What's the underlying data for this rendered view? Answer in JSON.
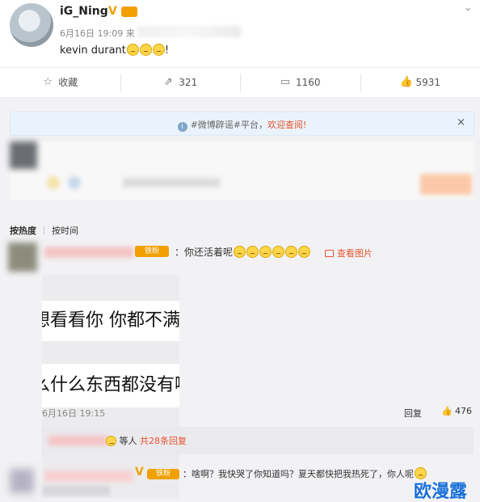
{
  "post": {
    "username": "iG_Ning",
    "time": "6月16日 19:09 来",
    "text": "kevin durant",
    "text_suffix": "!",
    "verified_icon": "verified-v-icon"
  },
  "actions": [
    {
      "icon": "star-icon",
      "label": "收藏"
    },
    {
      "icon": "share-icon",
      "label": "321"
    },
    {
      "icon": "comment-icon",
      "label": "1160"
    },
    {
      "icon": "thumbs-up-icon",
      "label": "5931"
    }
  ],
  "notice": {
    "text": "#微博辟谣#平台，",
    "highlight": "欢迎查阅!",
    "close": "×"
  },
  "sort": {
    "hot": "按热度",
    "time": "按时间"
  },
  "comment1": {
    "fan_badge": "铁粉",
    "text": "：你还活着呢",
    "view_image": "查看图片",
    "image_line1": "想看看你 你都不满",
    "image_line2": "么什么东西都没有啊",
    "time": "6月16日 19:15",
    "reply": "回复",
    "likes": "476",
    "sub": {
      "mid": "等人",
      "count": "共28条回复"
    }
  },
  "comment2": {
    "fan_badge": "铁粉",
    "text": "：啥啊？我快哭了你知道吗？夏天都快把我热死了，你人呢"
  },
  "watermark": "欧漫露",
  "colors": {
    "accent": "#e8532d",
    "badge": "#f0a000",
    "notice_bg": "#eaf3fb"
  }
}
